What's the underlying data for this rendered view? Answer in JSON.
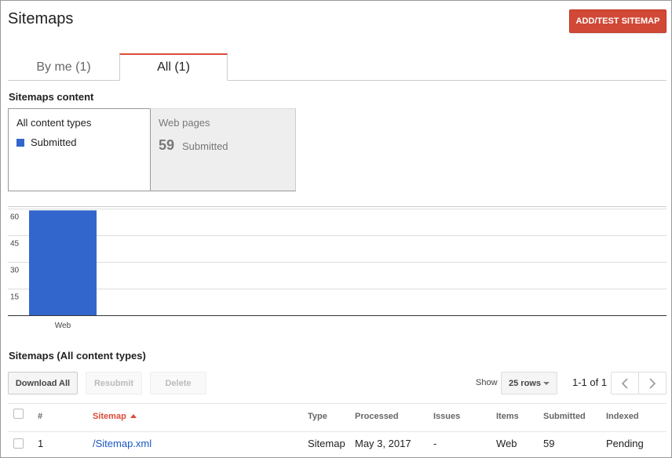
{
  "header": {
    "title": "Sitemaps",
    "add_button": "ADD/TEST SITEMAP"
  },
  "tabs": [
    {
      "label": "By me (1)",
      "active": false
    },
    {
      "label": "All (1)",
      "active": true
    }
  ],
  "content_section": {
    "title": "Sitemaps content",
    "all_card": {
      "title": "All content types",
      "legend_label": "Submitted",
      "legend_color": "#3366cc"
    },
    "web_card": {
      "title": "Web pages",
      "count": "59",
      "label": "Submitted"
    }
  },
  "chart_data": {
    "type": "bar",
    "categories": [
      "Web"
    ],
    "series": [
      {
        "name": "Submitted",
        "values": [
          59
        ],
        "color": "#3366cc"
      }
    ],
    "ylim": [
      0,
      60
    ],
    "yticks": [
      15,
      30,
      45,
      60
    ],
    "ytick_labels": [
      "15",
      "30",
      "45",
      "60"
    ],
    "grid": true
  },
  "table_section": {
    "title": "Sitemaps (All content types)",
    "buttons": {
      "download": "Download All",
      "resubmit": "Resubmit",
      "delete": "Delete"
    },
    "show_label": "Show",
    "rows_selected": "25 rows",
    "page_range": "1-1 of 1",
    "columns": [
      "#",
      "Sitemap",
      "Type",
      "Processed",
      "Issues",
      "Items",
      "Submitted",
      "Indexed"
    ],
    "rows": [
      {
        "num": "1",
        "sitemap": "/Sitemap.xml",
        "type": "Sitemap",
        "processed": "May 3, 2017",
        "issues": "-",
        "items": "Web",
        "submitted": "59",
        "indexed": "Pending"
      }
    ]
  }
}
